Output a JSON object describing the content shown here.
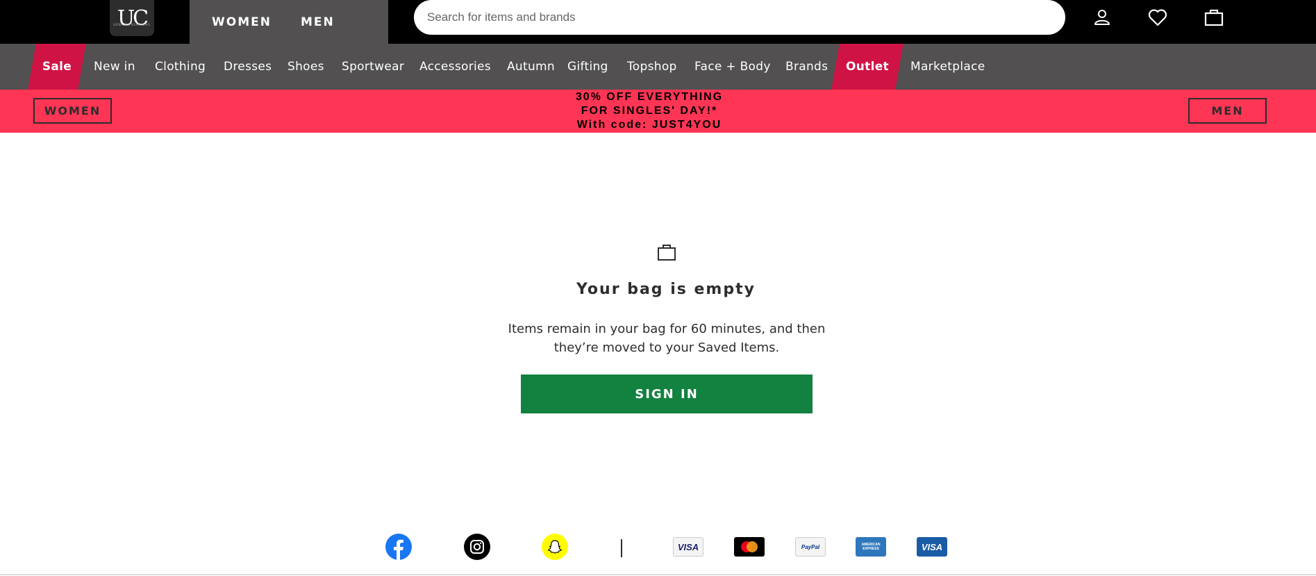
{
  "header": {
    "logo_text": "UC",
    "logo_subtext": "URBAN CREATIONS",
    "gender_tabs": [
      "WOMEN",
      "MEN"
    ],
    "search_placeholder": "Search for items and brands",
    "icons": [
      "account-icon",
      "heart-icon",
      "bag-icon"
    ]
  },
  "nav": {
    "items": [
      "Sale",
      "New in",
      "Clothing",
      "Dresses",
      "Shoes",
      "Sportwear",
      "Accessories",
      "Autumn",
      "Gifting",
      "Topshop",
      "Face + Body",
      "Brands",
      "Outlet",
      "Marketplace"
    ],
    "highlight_color": "#d01345"
  },
  "promo": {
    "women_label": "WOMEN",
    "men_label": "MEN",
    "line1": "30% OFF EVERYTHING",
    "line2": "FOR SINGLES' DAY!*",
    "line3": "With code: JUST4YOU",
    "background": "#fe3554"
  },
  "bag": {
    "title": "Your bag is empty",
    "message": "Items remain in your bag for 60 minutes, and then they’re moved to your Saved Items.",
    "signin_label": "SIGN IN",
    "signin_color": "#138140"
  },
  "footer": {
    "social": [
      "facebook-icon",
      "instagram-icon",
      "snapchat-icon"
    ],
    "payments": [
      "VISA",
      "mastercard",
      "PayPal",
      "AMERICAN EXPRESS",
      "VISA"
    ]
  }
}
